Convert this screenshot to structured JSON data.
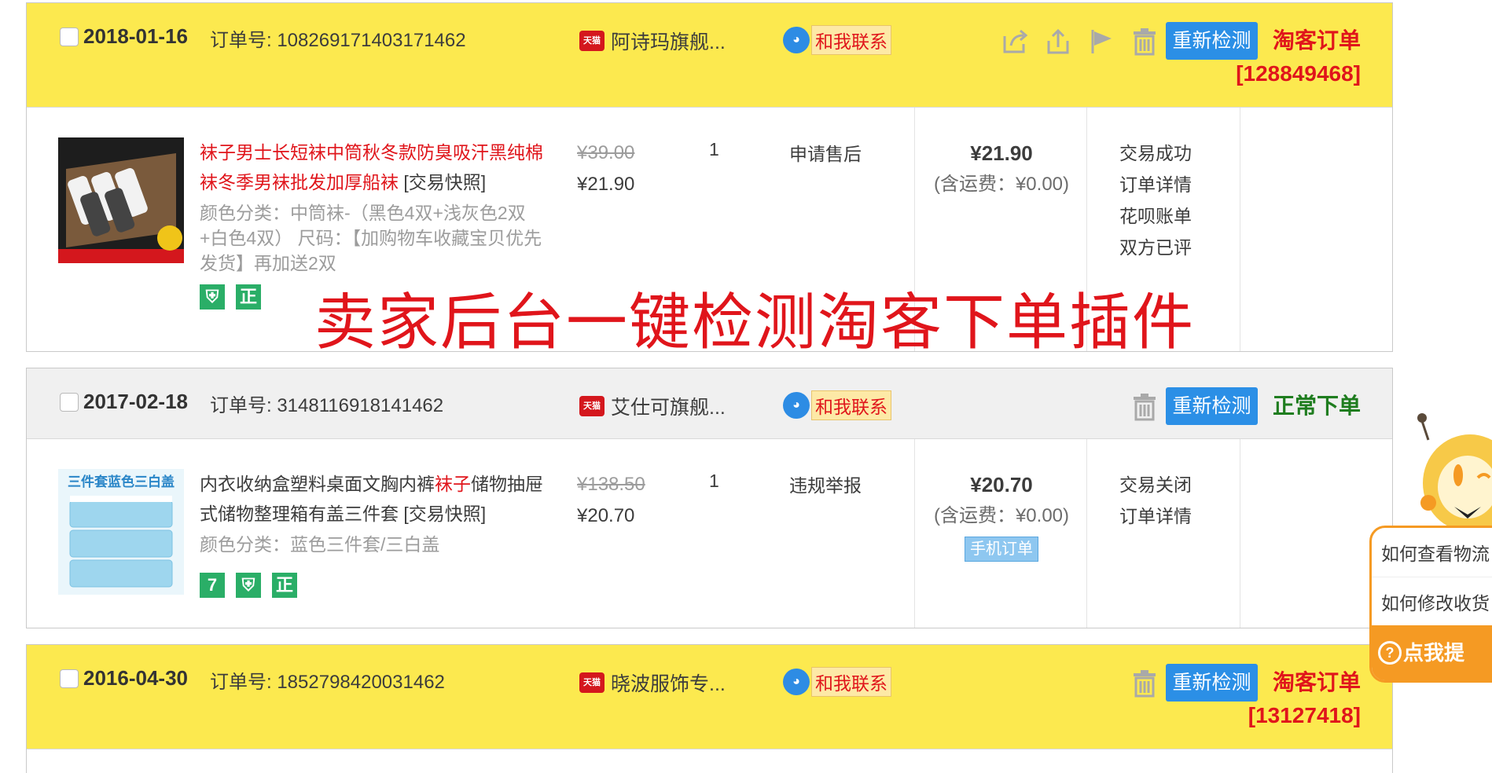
{
  "overlay_title": "卖家后台一键检测淘客下单插件",
  "recheck_label": "重新检测",
  "contact_label": "和我联系",
  "tmall_badge": "天猫",
  "orders": [
    {
      "date": "2018-01-16",
      "order_no": "订单号: 108269171403171462",
      "shop": "阿诗玛旗舰...",
      "type_label": "淘客订单",
      "pid": "[128849468]",
      "title_pre": "袜子",
      "title_hl": "男士长短袜中筒秋冬款防臭吸汗黑纯棉袜冬季男袜批发加厚船袜",
      "title_snap": "[交易快照]",
      "spec": "颜色分类：中筒袜-（黑色4双+浅灰色2双+白色4双）  尺码：【加购物车收藏宝贝优先发货】再加送2双",
      "orig_price": "¥39.00",
      "price": "¥21.90",
      "qty": "1",
      "after_sale": "申请售后",
      "total": "¥21.90",
      "shipping": "(含运费：¥0.00)",
      "status": [
        "交易成功",
        "订单详情",
        "花呗账单",
        "双方已评"
      ],
      "badges": [
        "正"
      ]
    },
    {
      "date": "2017-02-18",
      "order_no": "订单号: 3148116918141462",
      "shop": "艾仕可旗舰...",
      "type_label": "正常下单",
      "title_pre": "内衣收纳盒塑料桌面文胸内裤",
      "title_hl": "袜子",
      "title_post": "储物抽屉式储物整理箱有盖三件套",
      "title_snap": "[交易快照]",
      "spec": "颜色分类：蓝色三件套/三白盖",
      "orig_price": "¥138.50",
      "price": "¥20.70",
      "qty": "1",
      "after_sale": "违规举报",
      "total": "¥20.70",
      "shipping": "(含运费：¥0.00)",
      "mobile_tag": "手机订单",
      "status": [
        "交易关闭",
        "订单详情"
      ],
      "badges": [
        "7",
        "正"
      ],
      "thumb_text": "三件套蓝色三白盖"
    },
    {
      "date": "2016-04-30",
      "order_no": "订单号: 1852798420031462",
      "shop": "晓波服饰专...",
      "type_label": "淘客订单",
      "pid": "[13127418]"
    }
  ],
  "help_panel": {
    "q1": "如何查看物流",
    "q2": "如何修改收货",
    "cta": "点我提"
  },
  "colors": {
    "taoke_header": "#fce94f",
    "normal_header": "#f0f0f0",
    "accent_blue": "#2b8fe6",
    "accent_red": "#e0151b",
    "accent_green": "#1f7d1f",
    "help_orange": "#f59a23"
  }
}
